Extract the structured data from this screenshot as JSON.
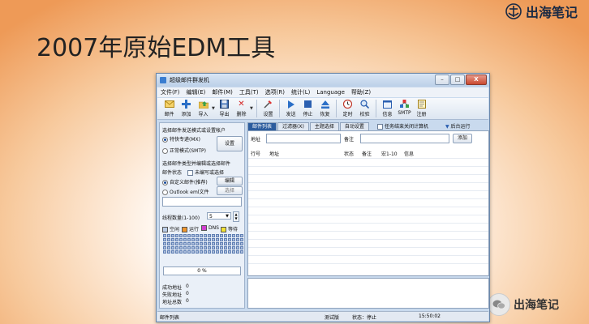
{
  "slide": {
    "title": "2007年原始EDM工具",
    "brand": "出海笔记",
    "watermark": "出海笔记"
  },
  "window": {
    "title": "超级邮件群发机",
    "buttons": {
      "minimize": "–",
      "maximize": "□",
      "close": "X"
    },
    "menu": [
      "文件(F)",
      "编辑(E)",
      "邮件(M)",
      "工具(T)",
      "选项(R)",
      "统计(L)",
      "Language",
      "帮助(Z)"
    ],
    "toolbar": [
      {
        "label": "邮件",
        "icon": "envelope-icon"
      },
      {
        "label": "添加",
        "icon": "add-icon"
      },
      {
        "label": "导入",
        "icon": "import-icon"
      },
      {
        "label": "导出",
        "icon": "export-icon"
      },
      {
        "label": "删除",
        "icon": "delete-icon"
      },
      {
        "label": "设置",
        "icon": "settings-icon"
      },
      {
        "label": "发送",
        "icon": "send-icon"
      },
      {
        "label": "停止",
        "icon": "stop-icon"
      },
      {
        "label": "恢复",
        "icon": "resume-icon"
      },
      {
        "label": "定时",
        "icon": "clock-icon"
      },
      {
        "label": "校验",
        "icon": "verify-icon"
      },
      {
        "label": "信息",
        "icon": "info-icon"
      },
      {
        "label": "SMTP",
        "icon": "smtp-icon"
      },
      {
        "label": "注册",
        "icon": "register-icon"
      }
    ],
    "left": {
      "mode_header": "选择邮件发送模式或设置帐户",
      "mode_special": "特快专递(MX)",
      "mode_normal": "正常模式(SMTP)",
      "settings_button": "设置",
      "type_header": "选择邮件类型并编辑或选择邮件",
      "status_label": "邮件状态",
      "status_check": "未编写或选择",
      "custom_label": "自定义邮件(推荐)",
      "edit_button": "编辑",
      "outlook_label": "Outlook eml文件",
      "select_button": "选择",
      "threads_label": "线程数量(1-100)",
      "threads_value": "5",
      "legend": [
        {
          "label": "空闲",
          "color": "#b9cbe6"
        },
        {
          "label": "运行",
          "color": "#f0962c"
        },
        {
          "label": "DNS",
          "color": "#d13fd0"
        },
        {
          "label": "等待",
          "color": "#f2e233"
        }
      ],
      "progress_text": "0 %",
      "progress": 0,
      "success_label": "成功地址",
      "success_value": "0",
      "fail_label": "失败地址",
      "fail_value": "0",
      "total_label": "地址总数",
      "total_value": "0"
    },
    "tabs": [
      "邮件列表",
      "过滤器(X)",
      "主题选择",
      "自动设置"
    ],
    "shutdown_label": "任务结束关闭计算机",
    "background_label": "后台运行",
    "address_label": "地址",
    "remark_label": "备注",
    "add_button": "添加",
    "columns": [
      "行号",
      "地址",
      "状态",
      "备注",
      "宏1-10",
      "信息"
    ],
    "status": {
      "left": "邮件列表",
      "mode": "测试版",
      "state": "状态：停止",
      "time": "15:50:02"
    }
  }
}
